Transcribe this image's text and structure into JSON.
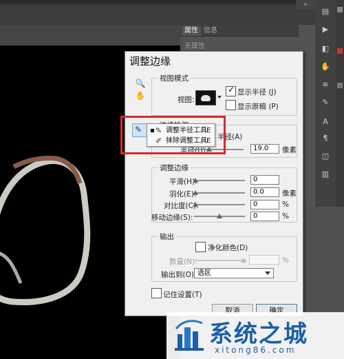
{
  "panel": {
    "tabs": [
      "属性",
      "信息"
    ],
    "empty_text": "无属性"
  },
  "dialog": {
    "title": "调整边缘",
    "view_mode": {
      "group_label": "视图模式",
      "view_label": "视图:",
      "show_radius": "显示半径 (J)",
      "show_radius_checked": true,
      "show_original": "显示原稿 (P)",
      "show_original_checked": false
    },
    "edge_detection": {
      "group_label": "边缘检测",
      "smart_radius_fragment": "半径(A)",
      "radius_label": "半径(U):",
      "radius_value": "19.0",
      "radius_unit": "像素",
      "radius_level_px": 19.0,
      "radius_max_px": 250
    },
    "adjust_edge": {
      "group_label": "调整边缘",
      "rows": [
        {
          "label": "平滑(H):",
          "value": "0",
          "unit": ""
        },
        {
          "label": "羽化(E):",
          "value": "0.0",
          "unit": "像素"
        },
        {
          "label": "对比度(C):",
          "value": "0",
          "unit": "%"
        },
        {
          "label": "移动边缘(S):",
          "value": "0",
          "unit": "%"
        }
      ]
    },
    "output": {
      "group_label": "输出",
      "decontaminate": "净化颜色(D)",
      "amount_label": "数量(N):",
      "amount_unit": "%",
      "output_to_label": "输出到(O):",
      "output_to_value": "选区"
    },
    "remember": "记住设置(T)",
    "cancel": "取消",
    "ok": "确定"
  },
  "flyout": {
    "items": [
      {
        "label": "调整半径工具",
        "key": "E",
        "selected": true,
        "icon": "brush-icon"
      },
      {
        "label": "抹除调整工具",
        "key": "E",
        "selected": false,
        "icon": "eraser-icon"
      }
    ]
  },
  "watermark": {
    "title": "系统之城",
    "url": "xitong86.com"
  },
  "colors": {
    "highlight": "#d52b2b",
    "watermark_blue": "#1b5fa8",
    "dialog_bg": "#f0f0f0"
  }
}
